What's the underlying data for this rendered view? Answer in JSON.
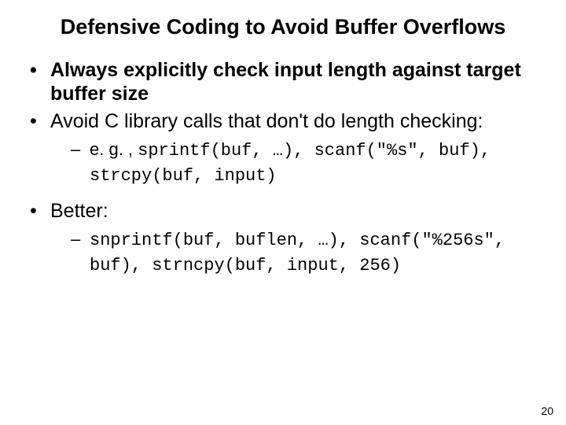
{
  "title": "Defensive Coding to Avoid Buffer Overflows",
  "bullets": {
    "b1": "Always explicitly check input length against target buffer size",
    "b2": "Avoid C library calls that don't do length checking:",
    "b2_sub_prefix": "e. g. , ",
    "b2_sub_code": "sprintf(buf, …), scanf(\"%s\", buf), strcpy(buf, input)",
    "b3": "Better:",
    "b3_sub_code": "snprintf(buf, buflen, …), scanf(\"%256s\", buf), strncpy(buf, input, 256)"
  },
  "page_number": "20"
}
